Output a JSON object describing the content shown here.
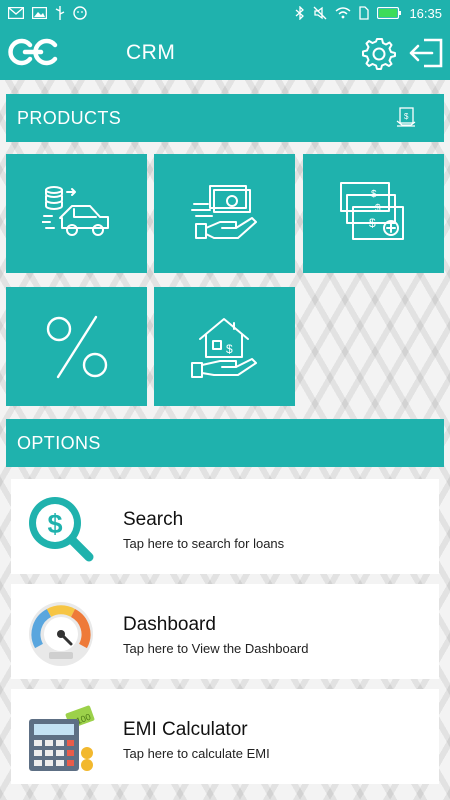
{
  "status_bar": {
    "time": "16:35",
    "left_icons": [
      "mail-icon",
      "image-icon",
      "usb-icon",
      "smiley-icon"
    ],
    "right_icons": [
      "bluetooth-icon",
      "mute-icon",
      "wifi-icon",
      "sim-icon",
      "battery-icon"
    ]
  },
  "app_bar": {
    "title": "CRM",
    "colors": {
      "primary": "#1fb2ad"
    }
  },
  "products": {
    "header": "PRODUCTS",
    "tiles": [
      {
        "icon": "vehicle-loan-icon"
      },
      {
        "icon": "cash-in-hand-icon"
      },
      {
        "icon": "money-stack-icon"
      },
      {
        "icon": "percent-icon"
      },
      {
        "icon": "home-loan-icon"
      }
    ]
  },
  "options": {
    "header": "OPTIONS",
    "items": [
      {
        "title": "Search",
        "subtitle": "Tap here to search for loans",
        "icon": "dollar-search-icon"
      },
      {
        "title": "Dashboard",
        "subtitle": "Tap here to View the Dashboard",
        "icon": "speedometer-icon"
      },
      {
        "title": "EMI Calculator",
        "subtitle": "Tap here to calculate EMI",
        "icon": "calculator-icon"
      }
    ]
  }
}
